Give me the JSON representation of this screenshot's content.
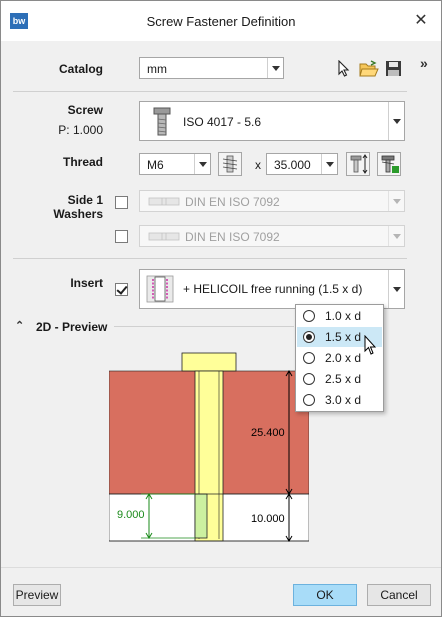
{
  "window": {
    "title": "Screw Fastener Definition",
    "logo_text": "bw"
  },
  "catalog": {
    "label": "Catalog",
    "value": "mm"
  },
  "screw": {
    "label": "Screw",
    "sublabel": "P: 1.000",
    "value": "ISO 4017 - 5.6"
  },
  "thread": {
    "label": "Thread",
    "size": "M6",
    "times": "x",
    "length": "35.000"
  },
  "washers": {
    "label_line1": "Side 1",
    "label_line2": "Washers",
    "row1_value": "DIN EN ISO 7092",
    "row2_value": "DIN EN ISO 7092"
  },
  "insert": {
    "label": "Insert",
    "value": "+ HELICOIL free running (1.5 x d)",
    "options": [
      "1.0 x d",
      "1.5 x d",
      "2.0 x d",
      "2.5 x d",
      "3.0 x d"
    ],
    "selected": "1.5 x d"
  },
  "preview": {
    "section_title": "2D - Preview",
    "dim_top": "25.400",
    "dim_bottom": "10.000",
    "dim_insert": "9.000",
    "colors": {
      "plate": "#d86f5f",
      "screw": "#ffff99",
      "insert": "#ccf0a0",
      "dim": "#000000",
      "dim_green": "#1a8a1a"
    }
  },
  "footer": {
    "preview_button": "Preview",
    "ok_button": "OK",
    "cancel_button": "Cancel"
  }
}
